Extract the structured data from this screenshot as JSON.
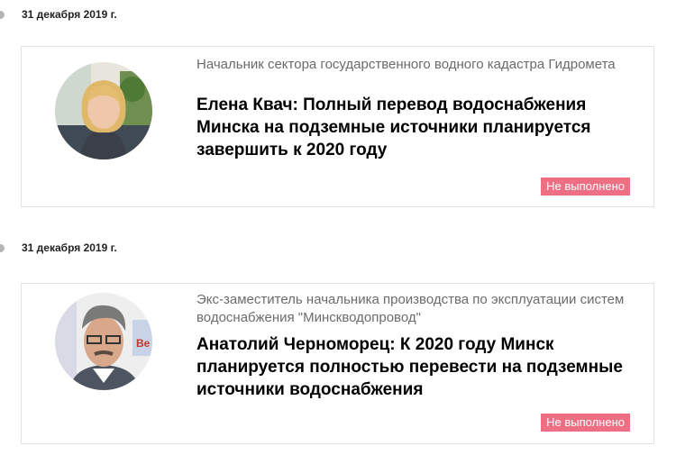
{
  "feed": [
    {
      "date": "31 декабря 2019 г.",
      "position": "Начальник сектора государственного водного кадастра Гидромета",
      "headline": "Елена Квач: Полный перевод водоснабжения Минска на подземные источники планируется завершить к 2020 году",
      "status": "Не выполнено"
    },
    {
      "date": "31 декабря 2019 г.",
      "position": "Экс-заместитель начальника производства по эксплуатации систем водоснабжения \"Минскводопровод\"",
      "headline": "Анатолий Черноморец: К 2020 году Минск планируется полностью перевести на подземные источники водоснабжения",
      "status": "Не выполнено"
    }
  ],
  "colors": {
    "status_badge": "#ee6f84",
    "position_text": "#6b6b6b",
    "card_border": "#e3e3e3"
  }
}
